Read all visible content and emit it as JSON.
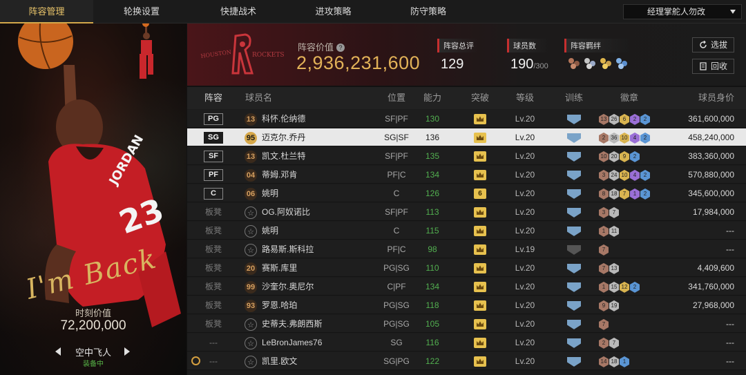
{
  "nav": {
    "tabs": [
      {
        "label": "阵容管理",
        "active": true
      },
      {
        "label": "轮换设置",
        "active": false
      },
      {
        "label": "快捷战术",
        "active": false
      },
      {
        "label": "进攻策略",
        "active": false
      },
      {
        "label": "防守策略",
        "active": false
      }
    ],
    "manager_select": "经理掌舵人勿改"
  },
  "player_card": {
    "signature": "I'm Back",
    "jersey": "JORDAN 23",
    "moment_label": "时刻价值",
    "moment_value": "72,200,000",
    "skin_name": "空中飞人",
    "skin_status": "装备中"
  },
  "team": {
    "logo_text": "HOUSTON ROCKETS",
    "lineup_value_label": "阵容价值",
    "lineup_value": "2,936,231,600",
    "stats": [
      {
        "title": "阵容总评",
        "value": "129",
        "sub": ""
      },
      {
        "title": "球员数",
        "value": "190",
        "sub": "/300"
      },
      {
        "title": "阵容羁绊",
        "value": "",
        "sub": ""
      }
    ],
    "buttons": {
      "swap": "选拔",
      "recycle": "回收"
    },
    "colors": {
      "accent_gold": "#e2b258",
      "accent_red": "#c62f2f"
    }
  },
  "table": {
    "headers": {
      "lineup": "阵容",
      "name": "球员名",
      "position": "位置",
      "rating": "能力",
      "breakthrough": "突破",
      "level": "等级",
      "training": "训练",
      "badges": "徽章",
      "value": "球员身价"
    },
    "rows": [
      {
        "slot": "PG",
        "starter": true,
        "ovr": "13",
        "name": "科怀.伦纳德",
        "position": "SF|PF",
        "rating": "130",
        "breakthrough": "crown",
        "level": "Lv.20",
        "training": "blue",
        "badges": [
          [
            "b-bronze",
            "13"
          ],
          [
            "b-silver",
            "26"
          ],
          [
            "b-gold",
            "6"
          ],
          [
            "b-purple",
            "2"
          ],
          [
            "b-blue",
            "2"
          ]
        ],
        "value": "361,600,000",
        "selected": false
      },
      {
        "slot": "SG",
        "starter": true,
        "ovr": "95",
        "name": "迈克尔.乔丹",
        "position": "SG|SF",
        "rating": "136",
        "breakthrough": "crown",
        "level": "Lv.20",
        "training": "blue",
        "badges": [
          [
            "b-bronze",
            "2"
          ],
          [
            "b-silver",
            "36"
          ],
          [
            "b-gold",
            "10"
          ],
          [
            "b-purple",
            "4"
          ],
          [
            "b-blue",
            "2"
          ]
        ],
        "value": "458,240,000",
        "selected": true
      },
      {
        "slot": "SF",
        "starter": true,
        "ovr": "13",
        "name": "凯文.杜兰特",
        "position": "SF|PF",
        "rating": "135",
        "breakthrough": "crown",
        "level": "Lv.20",
        "training": "blue",
        "badges": [
          [
            "b-bronze",
            "10"
          ],
          [
            "b-silver",
            "20"
          ],
          [
            "b-gold",
            "9"
          ],
          [
            "b-blue",
            "2"
          ]
        ],
        "value": "383,360,000",
        "selected": false
      },
      {
        "slot": "PF",
        "starter": true,
        "ovr": "04",
        "name": "蒂姆.邓肯",
        "position": "PF|C",
        "rating": "134",
        "breakthrough": "crown",
        "level": "Lv.20",
        "training": "blue",
        "badges": [
          [
            "b-bronze",
            "3"
          ],
          [
            "b-silver",
            "24"
          ],
          [
            "b-gold",
            "10"
          ],
          [
            "b-purple",
            "4"
          ],
          [
            "b-blue",
            "2"
          ]
        ],
        "value": "570,880,000",
        "selected": false
      },
      {
        "slot": "C",
        "starter": true,
        "ovr": "06",
        "name": "姚明",
        "position": "C",
        "rating": "126",
        "breakthrough": "6",
        "level": "Lv.20",
        "training": "blue",
        "badges": [
          [
            "b-bronze",
            "8"
          ],
          [
            "b-silver",
            "18"
          ],
          [
            "b-gold",
            "7"
          ],
          [
            "b-purple",
            "1"
          ],
          [
            "b-blue",
            "2"
          ]
        ],
        "value": "345,600,000",
        "selected": false
      },
      {
        "slot": "板凳",
        "starter": false,
        "ovr": "",
        "name": "OG.阿奴诺比",
        "position": "SF|PF",
        "rating": "113",
        "breakthrough": "crown",
        "level": "Lv.20",
        "training": "blue",
        "badges": [
          [
            "b-bronze",
            "3"
          ],
          [
            "b-silver",
            "7"
          ]
        ],
        "value": "17,984,000",
        "selected": false
      },
      {
        "slot": "板凳",
        "starter": false,
        "ovr": "",
        "name": "姚明",
        "position": "C",
        "rating": "115",
        "breakthrough": "crown",
        "level": "Lv.20",
        "training": "blue",
        "badges": [
          [
            "b-bronze",
            "1"
          ],
          [
            "b-silver",
            "11"
          ]
        ],
        "value": "---",
        "selected": false
      },
      {
        "slot": "板凳",
        "starter": false,
        "ovr": "",
        "name": "路易斯.斯科拉",
        "position": "PF|C",
        "rating": "98",
        "breakthrough": "crown",
        "level": "Lv.19",
        "training": "grey",
        "badges": [
          [
            "b-bronze",
            "7"
          ]
        ],
        "value": "---",
        "selected": false
      },
      {
        "slot": "板凳",
        "starter": false,
        "ovr": "20",
        "name": "赛斯.库里",
        "position": "PG|SG",
        "rating": "110",
        "breakthrough": "crown",
        "level": "Lv.20",
        "training": "blue",
        "badges": [
          [
            "b-bronze",
            "7"
          ],
          [
            "b-silver",
            "13"
          ]
        ],
        "value": "4,409,600",
        "selected": false
      },
      {
        "slot": "板凳",
        "starter": false,
        "ovr": "99",
        "name": "沙奎尔.奥尼尔",
        "position": "C|PF",
        "rating": "134",
        "breakthrough": "crown",
        "level": "Lv.20",
        "training": "blue",
        "badges": [
          [
            "b-bronze",
            "1"
          ],
          [
            "b-silver",
            "15"
          ],
          [
            "b-gold",
            "12"
          ],
          [
            "b-blue",
            "2"
          ]
        ],
        "value": "341,760,000",
        "selected": false
      },
      {
        "slot": "板凳",
        "starter": false,
        "ovr": "93",
        "name": "罗恩.哈珀",
        "position": "PG|SG",
        "rating": "118",
        "breakthrough": "crown",
        "level": "Lv.20",
        "training": "blue",
        "badges": [
          [
            "b-bronze",
            "9"
          ],
          [
            "b-silver",
            "19"
          ]
        ],
        "value": "27,968,000",
        "selected": false
      },
      {
        "slot": "板凳",
        "starter": false,
        "ovr": "",
        "name": "史蒂夫.弗朗西斯",
        "position": "PG|SG",
        "rating": "105",
        "breakthrough": "crown",
        "level": "Lv.20",
        "training": "blue",
        "badges": [
          [
            "b-bronze",
            "7"
          ]
        ],
        "value": "---",
        "selected": false
      },
      {
        "slot": "---",
        "starter": false,
        "ovr": "",
        "name": "LeBronJames76",
        "position": "SG",
        "rating": "116",
        "breakthrough": "crown",
        "level": "Lv.20",
        "training": "blue",
        "badges": [
          [
            "b-bronze",
            "2"
          ],
          [
            "b-silver",
            "7"
          ]
        ],
        "value": "---",
        "selected": false
      },
      {
        "slot": "---",
        "starter": false,
        "ovr": "",
        "name": "凯里.欧文",
        "position": "SG|PG",
        "rating": "122",
        "breakthrough": "crown",
        "level": "Lv.20",
        "training": "blue",
        "badges": [
          [
            "b-bronze",
            "14"
          ],
          [
            "b-silver",
            "18"
          ],
          [
            "b-blue",
            "1"
          ]
        ],
        "value": "---",
        "selected": false
      }
    ]
  }
}
